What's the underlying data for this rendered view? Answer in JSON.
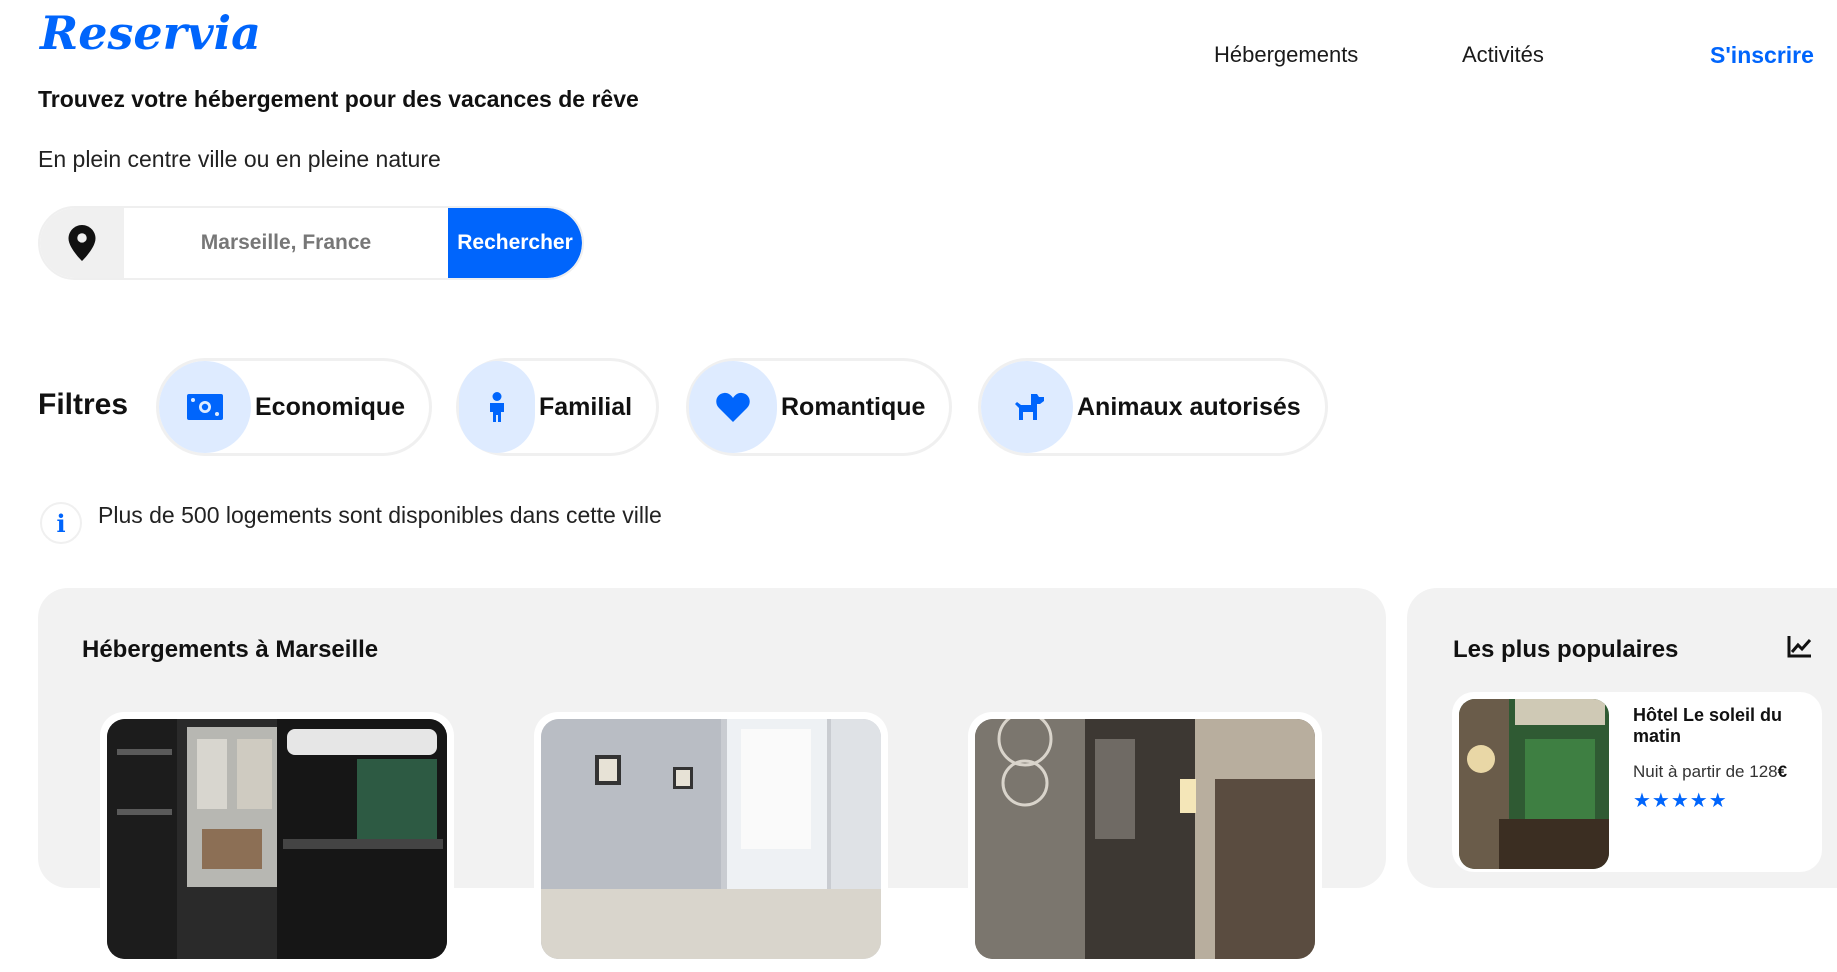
{
  "header": {
    "logo": "Reservia",
    "nav": [
      {
        "label": "Hébergements"
      },
      {
        "label": "Activités"
      },
      {
        "label": "S'inscrire"
      }
    ]
  },
  "hero": {
    "title": "Trouvez votre hébergement pour des vacances de rêve",
    "subtitle": "En plein centre ville ou en pleine nature"
  },
  "search": {
    "placeholder": "Marseille, France",
    "button_label": "Rechercher",
    "icon": "map-pin-icon"
  },
  "filters": {
    "label": "Filtres",
    "items": [
      {
        "label": "Economique",
        "icon": "money-icon"
      },
      {
        "label": "Familial",
        "icon": "child-icon"
      },
      {
        "label": "Romantique",
        "icon": "heart-icon"
      },
      {
        "label": "Animaux autorisés",
        "icon": "dog-icon"
      }
    ]
  },
  "info": {
    "text": "Plus de 500 logements sont disponibles dans cette ville",
    "icon": "info-icon"
  },
  "listings": {
    "title": "Hébergements à Marseille",
    "cards": [
      {
        "image": "hostel-bunk-room"
      },
      {
        "image": "bright-bedroom"
      },
      {
        "image": "hotel-room-lamp"
      }
    ]
  },
  "popular": {
    "title": "Les plus populaires",
    "icon": "trend-chart-icon",
    "items": [
      {
        "name": "Hôtel Le soleil du matin",
        "price_prefix": "Nuit à partir de",
        "price": "128",
        "currency": "€",
        "rating_stars": 5
      }
    ]
  },
  "colors": {
    "accent": "#0065fc",
    "light_accent": "#deebff",
    "panel_bg": "#f2f2f2"
  }
}
